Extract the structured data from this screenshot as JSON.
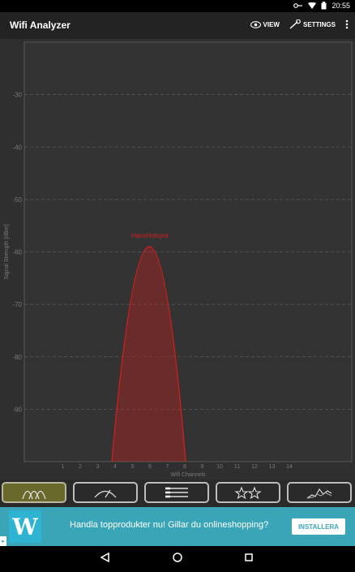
{
  "status": {
    "time": "20:55"
  },
  "app": {
    "title": "Wifi Analyzer",
    "actions": {
      "view": "VIEW",
      "settings": "SETTINGS"
    }
  },
  "chart_data": {
    "type": "area",
    "xlabel": "Wifi Channels",
    "ylabel": "Signal Strength [dBm]",
    "x_ticks": [
      "1",
      "2",
      "3",
      "4",
      "5",
      "6",
      "7",
      "8",
      "9",
      "10",
      "11",
      "12",
      "13",
      "14"
    ],
    "y_ticks": [
      "-30",
      "-40",
      "-50",
      "-60",
      "-70",
      "-80",
      "-90"
    ],
    "ylim": [
      -100,
      -20
    ],
    "grid": true,
    "series": [
      {
        "name": "HansHotspot",
        "channel": 6,
        "signal_dbm": -59,
        "channel_span": [
          4,
          8
        ],
        "color": "#d21e1e"
      }
    ]
  },
  "tabs": [
    {
      "name": "channel-graph",
      "active": true
    },
    {
      "name": "channel-rating",
      "active": false
    },
    {
      "name": "access-points",
      "active": false
    },
    {
      "name": "favorites",
      "active": false
    },
    {
      "name": "time-graph",
      "active": false
    }
  ],
  "ad": {
    "logo": "W",
    "text": "Handla topprodukter nu! Gillar du onlineshopping?",
    "button": "INSTALLERA"
  }
}
